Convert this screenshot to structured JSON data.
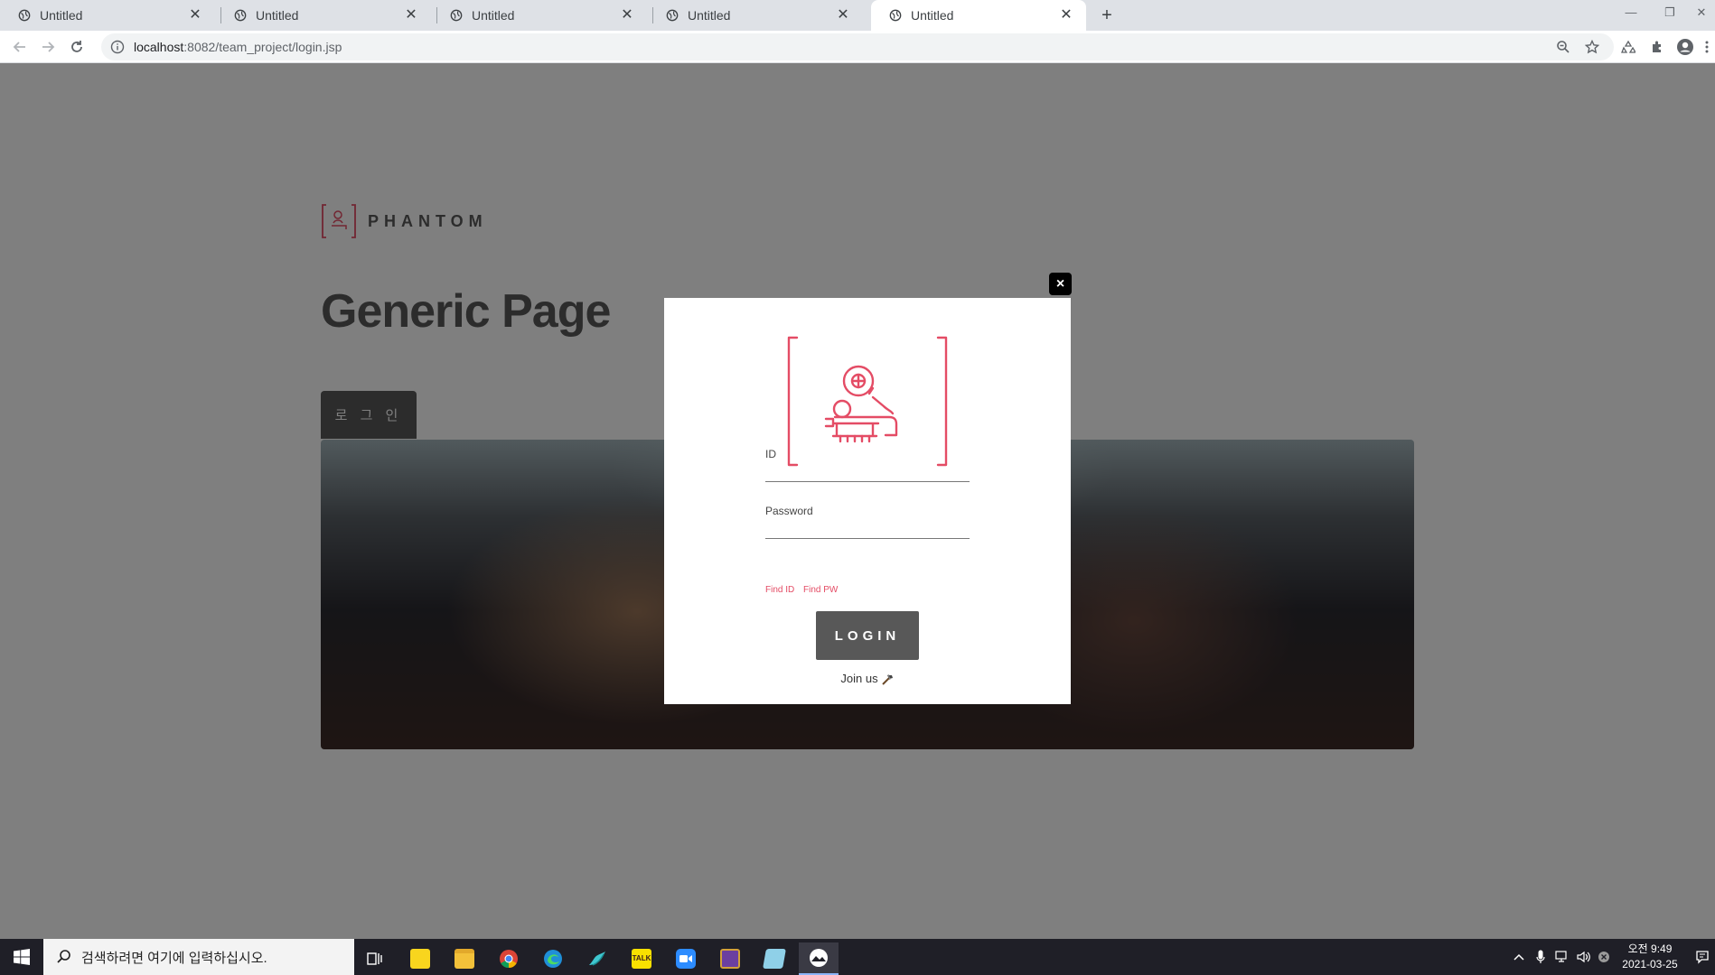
{
  "browser": {
    "tabs": [
      {
        "title": "Untitled",
        "active": false
      },
      {
        "title": "Untitled",
        "active": false
      },
      {
        "title": "Untitled",
        "active": false
      },
      {
        "title": "Untitled",
        "active": false
      },
      {
        "title": "Untitled",
        "active": true
      }
    ],
    "url_host": "localhost",
    "url_rest": ":8082/team_project/login.jsp"
  },
  "page": {
    "logo_text": "PHANTOM",
    "title": "Generic Page",
    "login_button": "로 그 인"
  },
  "modal": {
    "close_label": "×",
    "id_label": "ID",
    "id_value": "",
    "password_label": "Password",
    "password_value": "",
    "find_id": "Find ID",
    "find_pw": "Find PW",
    "submit_label": "LOGIN",
    "join_text": "Join us",
    "accent_color": "#e44c65"
  },
  "taskbar": {
    "search_placeholder": "검색하려면 여기에 입력하십시오.",
    "clock_time": "오전 9:49",
    "clock_date": "2021-03-25",
    "apps": [
      "task-view-icon",
      "sticky-notes-icon",
      "file-explorer-icon",
      "chrome-icon",
      "edge-icon",
      "app-bird-icon",
      "kakaotalk-icon",
      "zoom-icon",
      "game-icon",
      "notepad-icon",
      "photos-icon"
    ]
  }
}
